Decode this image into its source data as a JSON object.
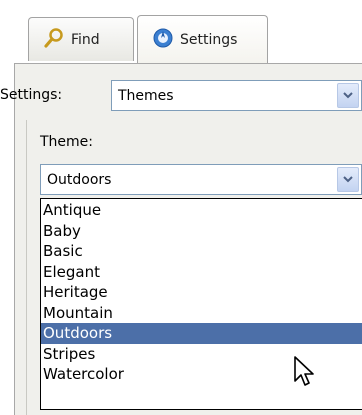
{
  "tabs": [
    {
      "label": "Find",
      "icon": "search-icon",
      "active": false
    },
    {
      "label": "Settings",
      "icon": "settings-icon",
      "active": true
    }
  ],
  "settings_field": {
    "label": "Settings:",
    "value": "Themes"
  },
  "theme_field": {
    "label": "Theme:",
    "value": "Outdoors"
  },
  "theme_options": [
    "Antique",
    "Baby",
    "Basic",
    "Elegant",
    "Heritage",
    "Mountain",
    "Outdoors",
    "Stripes",
    "Watercolor"
  ],
  "selected_option": "Outdoors",
  "colors": {
    "selection": "#4c6fa8",
    "combo_border": "#7f9db9",
    "pane_bg": "#f0f0ec"
  }
}
